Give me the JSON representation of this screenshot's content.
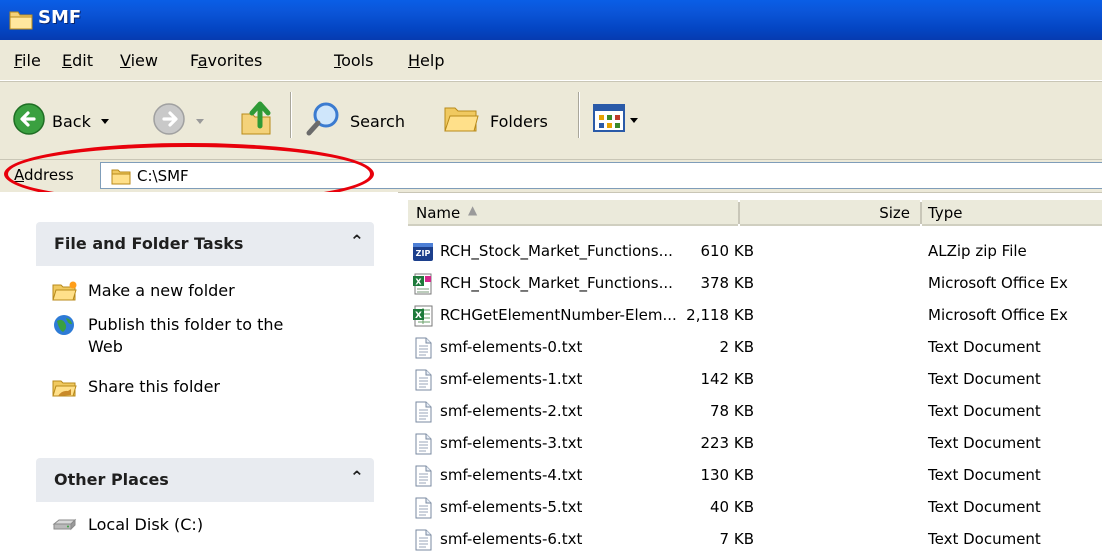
{
  "window": {
    "title": "SMF"
  },
  "menu": {
    "items": [
      {
        "label": "File",
        "accel": "F",
        "rest": "ile"
      },
      {
        "label": "Edit",
        "accel": "E",
        "rest": "dit"
      },
      {
        "label": "View",
        "accel": "V",
        "rest": "iew"
      },
      {
        "label": "Favorites",
        "pre": "F",
        "accel": "a",
        "rest": "vorites"
      },
      {
        "label": "Tools",
        "accel": "T",
        "rest": "ools"
      },
      {
        "label": "Help",
        "accel": "H",
        "rest": "elp"
      }
    ]
  },
  "toolbar": {
    "back_label": "Back",
    "search_label": "Search",
    "folders_label": "Folders"
  },
  "address": {
    "label_accel": "A",
    "label_rest": "ddress",
    "value": "C:\\SMF"
  },
  "taskpane": {
    "file_tasks": {
      "header": "File and Folder Tasks",
      "links": [
        "Make a new folder",
        "Publish this folder to the Web",
        "Share this folder"
      ]
    },
    "other_places": {
      "header": "Other Places",
      "links": [
        "Local Disk (C:)"
      ]
    }
  },
  "filelist": {
    "columns": {
      "name": "Name",
      "size": "Size",
      "type": "Type"
    },
    "files": [
      {
        "name": "RCH_Stock_Market_Functions...",
        "size": "610 KB",
        "type": "ALZip zip File",
        "icon": "zip-file-icon"
      },
      {
        "name": "RCH_Stock_Market_Functions...",
        "size": "378 KB",
        "type": "Microsoft Office Ex",
        "icon": "excel-addin-icon"
      },
      {
        "name": "RCHGetElementNumber-Elem...",
        "size": "2,118 KB",
        "type": "Microsoft Office Ex",
        "icon": "excel-file-icon"
      },
      {
        "name": "smf-elements-0.txt",
        "size": "2 KB",
        "type": "Text Document",
        "icon": "text-file-icon"
      },
      {
        "name": "smf-elements-1.txt",
        "size": "142 KB",
        "type": "Text Document",
        "icon": "text-file-icon"
      },
      {
        "name": "smf-elements-2.txt",
        "size": "78 KB",
        "type": "Text Document",
        "icon": "text-file-icon"
      },
      {
        "name": "smf-elements-3.txt",
        "size": "223 KB",
        "type": "Text Document",
        "icon": "text-file-icon"
      },
      {
        "name": "smf-elements-4.txt",
        "size": "130 KB",
        "type": "Text Document",
        "icon": "text-file-icon"
      },
      {
        "name": "smf-elements-5.txt",
        "size": "40 KB",
        "type": "Text Document",
        "icon": "text-file-icon"
      },
      {
        "name": "smf-elements-6.txt",
        "size": "7 KB",
        "type": "Text Document",
        "icon": "text-file-icon"
      }
    ]
  },
  "colors": {
    "titlebar": "#0b55d8",
    "toolbar_bg": "#ece9d8",
    "highlight_ellipse": "#e8000b",
    "taskpane_header": "#e8ebf0"
  }
}
